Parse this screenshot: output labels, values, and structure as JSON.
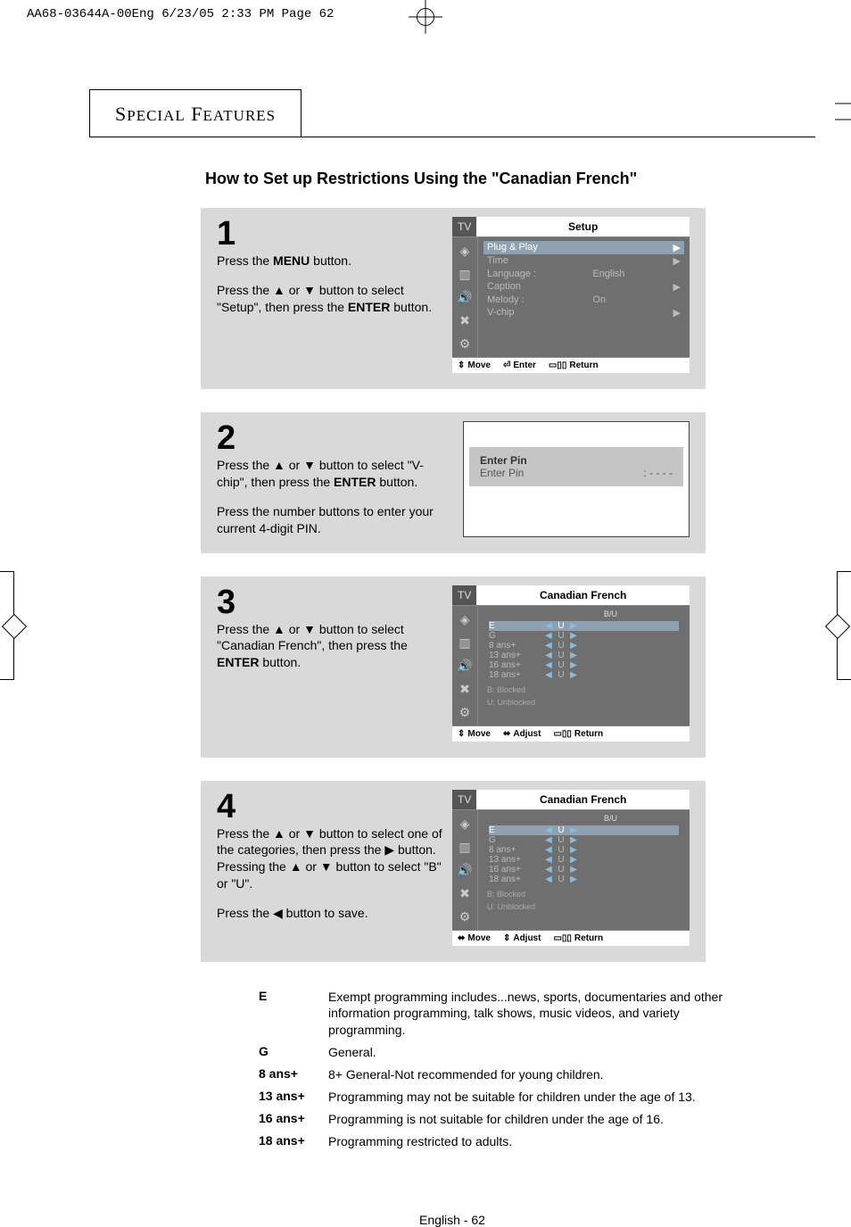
{
  "print_header": "AA68-03644A-00Eng  6/23/05  2:33 PM  Page 62",
  "section_header": "SPECIAL FEATURES",
  "main_title": "How to Set up Restrictions Using the \"Canadian French\"",
  "footer": "English - 62",
  "steps": {
    "s1": {
      "num": "1",
      "p1a": "Press the ",
      "p1b": "MENU",
      "p1c": " button.",
      "p2a": "Press the ▲ or ▼ button to select \"Setup\", then press the ",
      "p2b": "ENTER",
      "p2c": " button."
    },
    "s2": {
      "num": "2",
      "p1a": "Press the ▲ or ▼ button to select  \"V-chip\", then press the ",
      "p1b": "ENTER",
      "p1c": " button.",
      "p2": "Press the number buttons to enter your current 4-digit PIN."
    },
    "s3": {
      "num": "3",
      "p1a": "Press the ▲ or ▼ button to select \"Canadian French\", then press the ",
      "p1b": "ENTER",
      "p1c": " button."
    },
    "s4": {
      "num": "4",
      "p1": "Press the ▲ or ▼ button to select one of the categories, then press the ▶ button. Pressing the ▲ or ▼ button to select \"B\" or \"U\".",
      "p2": "Press the ◀ button to save."
    }
  },
  "osd_setup": {
    "tv": "TV",
    "title": "Setup",
    "rows": [
      {
        "label": "Plug & Play",
        "value": "",
        "tri": "▶",
        "sel": true
      },
      {
        "label": "Time",
        "value": "",
        "tri": "▶",
        "sel": false
      },
      {
        "label": "Language :",
        "value": "English",
        "tri": "",
        "sel": false
      },
      {
        "label": "Caption",
        "value": "",
        "tri": "▶",
        "sel": false
      },
      {
        "label": "Melody    :",
        "value": "On",
        "tri": "",
        "sel": false
      },
      {
        "label": "V-chip",
        "value": "",
        "tri": "▶",
        "sel": false
      }
    ],
    "footer": {
      "move": "Move",
      "enter": "Enter",
      "return": "Return"
    }
  },
  "osd_pin": {
    "title": "Enter Pin",
    "row_label": "Enter Pin",
    "row_value": ": - - - -"
  },
  "osd_cf": {
    "tv": "TV",
    "title": "Canadian French",
    "bu": "B/U",
    "rows": [
      {
        "label": "E",
        "sel": true,
        "u": "U"
      },
      {
        "label": "G",
        "sel": false,
        "u": "U"
      },
      {
        "label": "8  ans+",
        "sel": false,
        "u": "U"
      },
      {
        "label": "13 ans+",
        "sel": false,
        "u": "U"
      },
      {
        "label": "16 ans+",
        "sel": false,
        "u": "U"
      },
      {
        "label": "18 ans+",
        "sel": false,
        "u": "U"
      }
    ],
    "legend1": "B:   Blocked",
    "legend2": "U:   Unblocked",
    "footer": {
      "move": "Move",
      "adjust": "Adjust",
      "return": "Return"
    }
  },
  "definitions": [
    {
      "k": "E",
      "v": "Exempt programming includes...news, sports, documentaries and other information programming, talk shows, music videos, and  variety programming."
    },
    {
      "k": "G",
      "v": "General."
    },
    {
      "k": "8   ans+",
      "v": "8+ General-Not recommended for young children."
    },
    {
      "k": "13 ans+",
      "v": "Programming may not be suitable for children under the age of 13."
    },
    {
      "k": "16 ans+",
      "v": "Programming is not suitable for children under the age of 16."
    },
    {
      "k": "18 ans+",
      "v": "Programming restricted to adults."
    }
  ],
  "icons": {
    "updown": "⇕",
    "enter": "⏎",
    "menu": "▭▯▯",
    "leftright": "⬌"
  }
}
